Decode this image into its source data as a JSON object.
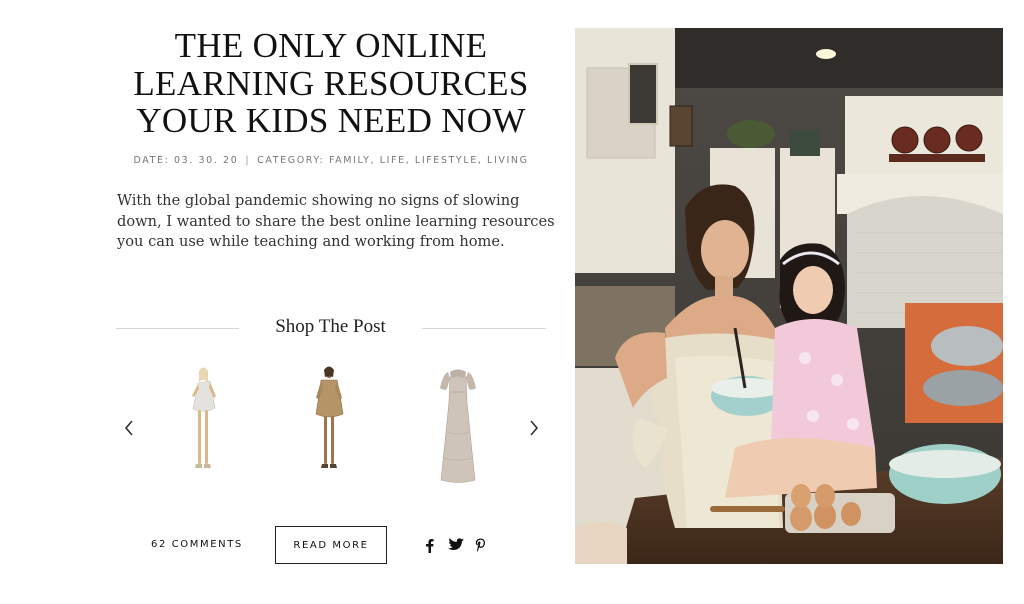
{
  "post": {
    "title_lines": [
      "THE ONLY ONLINE",
      "LEARNING RESOURCES",
      "YOUR KIDS NEED NOW"
    ],
    "meta": {
      "date": "DATE: 03. 30. 20",
      "separator": "|",
      "category": "CATEGORY: FAMILY, LIFE, LIFESTYLE, LIVING"
    },
    "excerpt_lines": [
      "With the global pandemic showing no signs of slowing",
      "down, I wanted to share the best online learning resources",
      "you can use while teaching and working from home."
    ]
  },
  "shop": {
    "heading": "Shop The Post",
    "products": [
      {
        "name": "silver one-shoulder mini dress",
        "icon": "dress-product-image"
      },
      {
        "name": "gold sequin mini dress",
        "icon": "dress-product-image"
      },
      {
        "name": "silver sequin midi dress",
        "icon": "dress-product-image"
      }
    ],
    "prev_icon": "chevron-left-icon",
    "next_icon": "chevron-right-icon"
  },
  "footer": {
    "comments": "62 COMMENTS",
    "read_more": "READ MORE",
    "social_icons": [
      "facebook-icon",
      "twitter-icon",
      "pinterest-icon"
    ]
  },
  "hero": {
    "description": "photo"
  }
}
